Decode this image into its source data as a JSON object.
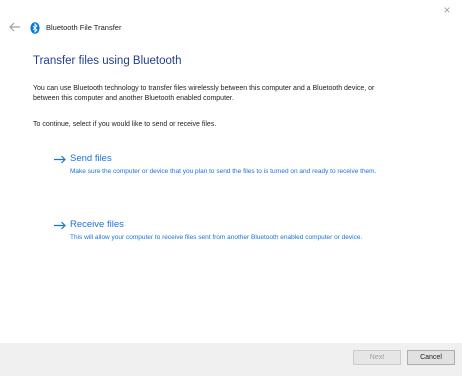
{
  "window": {
    "title": "Bluetooth File Transfer",
    "close_glyph": "×"
  },
  "heading": "Transfer files using Bluetooth",
  "intro": "You can use Bluetooth technology to transfer files wirelessly between this computer and a Bluetooth device, or between this computer and another Bluetooth enabled computer.",
  "prompt": "To continue, select if you would like to send or receive files.",
  "options": [
    {
      "title": "Send files",
      "description": "Make sure the computer or device that you plan to send the files to is turned on and ready to receive them."
    },
    {
      "title": "Receive files",
      "description": "This will allow your computer to receive files sent from another Bluetooth enabled computer or device."
    }
  ],
  "footer": {
    "next_label": "Next",
    "cancel_label": "Cancel"
  },
  "colors": {
    "heading": "#1f3f8f",
    "link": "#1a73d9",
    "bluetooth": "#0078d7",
    "footer_bg": "#f0f0f0"
  },
  "icons": {
    "back": "back-arrow-icon",
    "bluetooth": "bluetooth-icon",
    "option_arrow": "right-arrow-icon"
  }
}
